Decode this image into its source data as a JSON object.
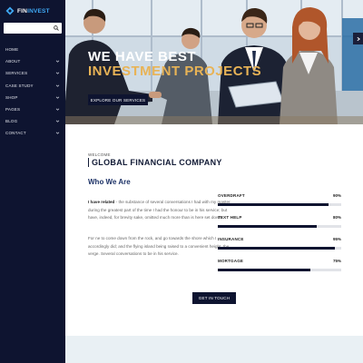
{
  "brand": {
    "part1": "FIN",
    "part2": "INVEST",
    "accent": "#3fa9f5"
  },
  "search": {
    "placeholder": "",
    "icon": "search-icon"
  },
  "sidebar": {
    "items": [
      {
        "label": "HOME",
        "has_children": false
      },
      {
        "label": "ABOUT",
        "has_children": true
      },
      {
        "label": "SERVICES",
        "has_children": true
      },
      {
        "label": "CASE STUDY",
        "has_children": true
      },
      {
        "label": "SHOP",
        "has_children": true
      },
      {
        "label": "PAGES",
        "has_children": true
      },
      {
        "label": "BLOG",
        "has_children": true
      },
      {
        "label": "CONTACT",
        "has_children": true
      }
    ]
  },
  "hero": {
    "title_line1": "WE HAVE BEST",
    "title_line2": "INVESTMENT PROJECTS",
    "button_label": "EXPLORE OUR SERVICES",
    "title_accent": "#e8b356"
  },
  "about": {
    "kicker": "WELCOME",
    "heading": "GLOBAL FINANCIAL COMPANY",
    "subheading": "Who We Are",
    "para1_lead": "I have related",
    "para1_rest": " - the substance of several conversations I had with my master during the greatest part of the time I had the honour to be in his service; but have, indeed, for brevity sake, omitted much more than is here set down.",
    "para2": "For ne to come down from the rock, and go towards the shore which I accordingly did; and the flying island being raised to a convenient height, the verge. Several conversations to be in his service.",
    "skills": [
      {
        "name": "OVERDRAFT",
        "value_label": "90%",
        "fraction": 0.9
      },
      {
        "name": "TEXT HELP",
        "value_label": "80%",
        "fraction": 0.8
      },
      {
        "name": "INSURANCE",
        "value_label": "95%",
        "fraction": 0.95
      },
      {
        "name": "MORTGAGE",
        "value_label": "75%",
        "fraction": 0.75
      }
    ],
    "cta_label": "GET IN TOUCH"
  },
  "colors": {
    "sidebar_bg": "#0e1430",
    "primary": "#0e1430",
    "heading": "#111a35"
  }
}
